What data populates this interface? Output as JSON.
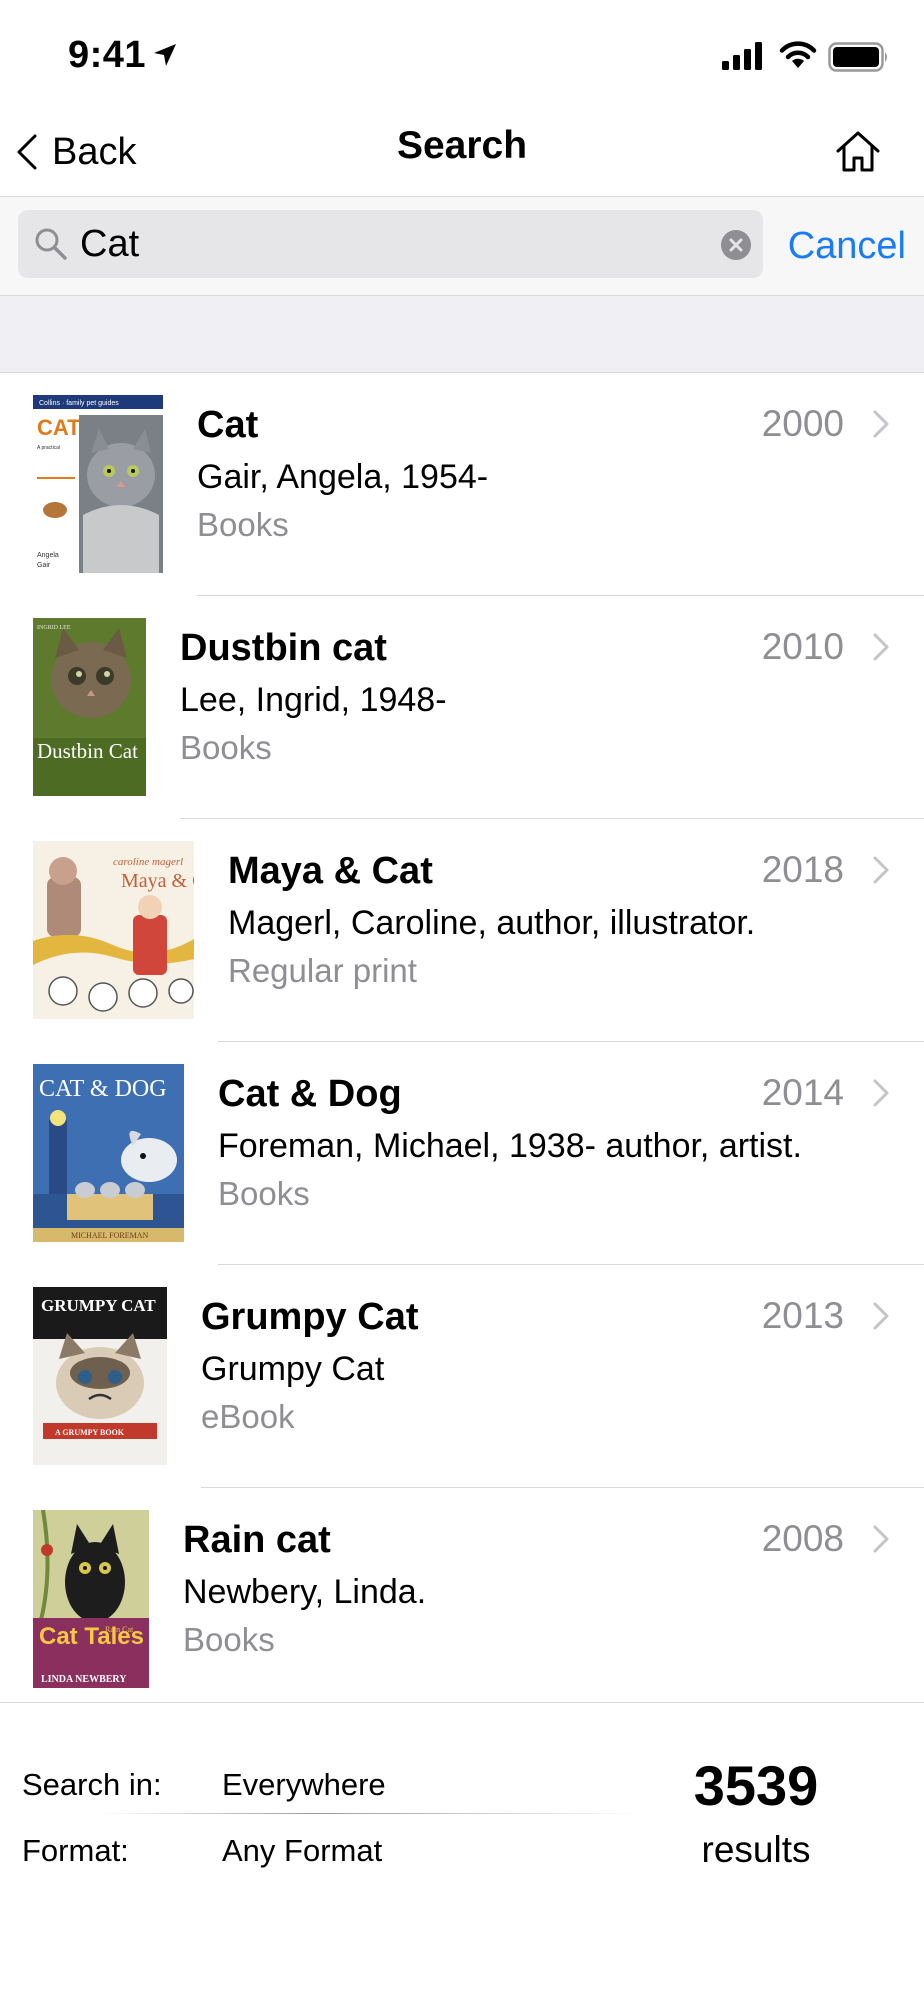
{
  "status_bar": {
    "time": "9:41"
  },
  "nav": {
    "back_label": "Back",
    "title": "Search"
  },
  "search": {
    "query": "Cat",
    "cancel_label": "Cancel"
  },
  "results": [
    {
      "title": "Cat",
      "author": "Gair, Angela, 1954-",
      "format": "Books",
      "year": "2000",
      "cover": {
        "top_text": "Collins · family pet guides",
        "big_text": "CAT",
        "blurb": "A practical guide to caring for your cat",
        "author_text": "Angela Gair"
      }
    },
    {
      "title": "Dustbin cat",
      "author": "Lee, Ingrid, 1948-",
      "format": "Books",
      "year": "2010",
      "cover": {
        "top_text": "INGRID LEE",
        "big_text": "Dustbin Cat"
      }
    },
    {
      "title": "Maya & Cat",
      "author": "Magerl, Caroline, author, illustrator.",
      "format": "Regular print",
      "year": "2018",
      "cover": {
        "top_text": "caroline magerl",
        "big_text": "Maya & Cat"
      }
    },
    {
      "title": "Cat & Dog",
      "author": "Foreman, Michael, 1938- author, artist.",
      "format": "Books",
      "year": "2014",
      "cover": {
        "big_text": "CAT & DOG",
        "author_text": "MICHAEL FOREMAN"
      }
    },
    {
      "title": "Grumpy Cat",
      "author": "Grumpy Cat",
      "format": "eBook",
      "year": "2013",
      "cover": {
        "big_text": "GRUMPY CAT",
        "banner_text": "A GRUMPY BOOK"
      }
    },
    {
      "title": "Rain cat",
      "author": "Newbery, Linda.",
      "format": "Books",
      "year": "2008",
      "cover": {
        "big_text": "Cat Tales",
        "small_text": "Rain Cat",
        "author_text": "LINDA NEWBERY"
      }
    }
  ],
  "footer": {
    "search_in_label": "Search in:",
    "search_in_value": "Everywhere",
    "format_label": "Format:",
    "format_value": "Any Format",
    "count": "3539",
    "count_label": "results"
  }
}
